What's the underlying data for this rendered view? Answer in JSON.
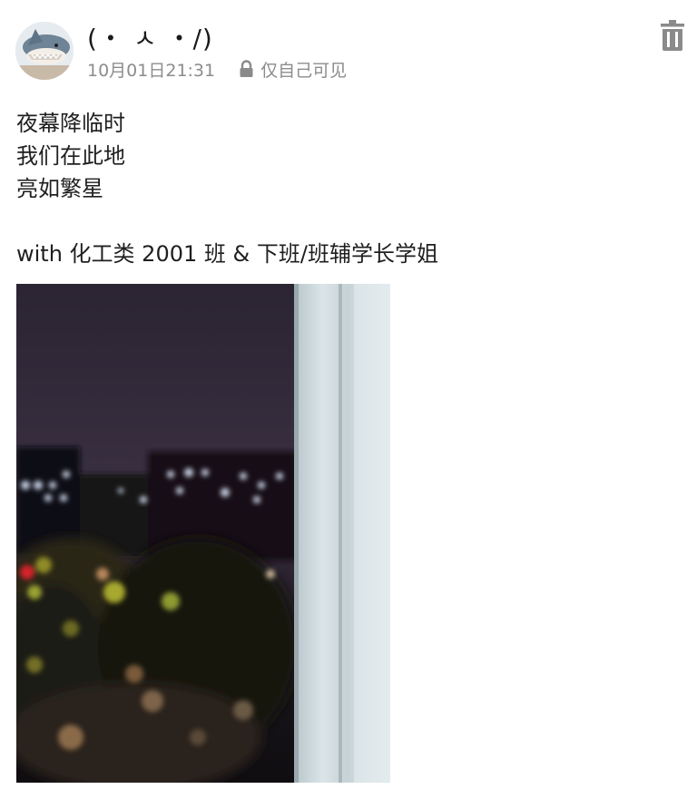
{
  "post": {
    "nickname": "(・ ㅅ ・/)",
    "timestamp": "10月01日21:31",
    "visibility": "仅自己可见",
    "content_lines": [
      "夜幕降临时",
      "我们在此地",
      "亮如繁星"
    ],
    "tagline": "with 化工类 2001 班 & 下班/班辅学长学姐"
  },
  "icons": {
    "avatar": "shark-avatar",
    "lock": "lock-icon",
    "delete": "trash-icon"
  },
  "colors": {
    "text": "#1f1f1f",
    "meta": "#8c8c8c",
    "icon": "#8a8a8a",
    "background": "#ffffff"
  }
}
